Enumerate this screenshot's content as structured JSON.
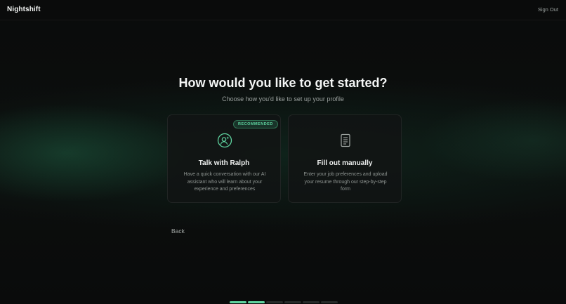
{
  "header": {
    "brand": "Nightshift",
    "sign_out_label": "Sign Out"
  },
  "main": {
    "title": "How would you like to get started?",
    "subtitle": "Choose how you'd like to set up your profile",
    "options": [
      {
        "badge": "RECOMMENDED",
        "icon": "ai-assistant-icon",
        "title": "Talk with Ralph",
        "description": "Have a quick conversation with our AI assistant who will learn about your experience and preferences"
      },
      {
        "icon": "document-icon",
        "title": "Fill out manually",
        "description": "Enter your job preferences and upload your resume through our step-by-step form"
      }
    ],
    "back_label": "Back"
  },
  "progress": {
    "total_steps": 6,
    "completed_steps": 2
  },
  "colors": {
    "accent": "#5fd4a0",
    "background": "#0b0c0c",
    "card": "#121414"
  }
}
